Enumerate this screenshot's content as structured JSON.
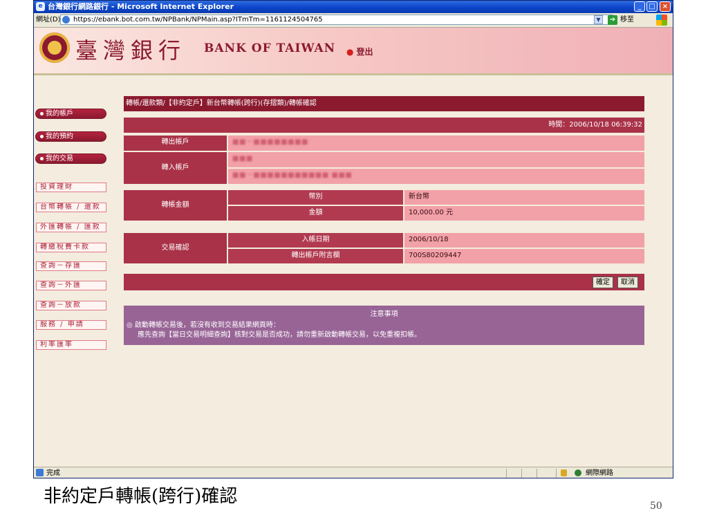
{
  "window": {
    "title": "台灣銀行網路銀行 - Microsoft Internet Explorer"
  },
  "addressbar": {
    "label": "網址(D)",
    "url": "https://ebank.bot.com.tw/NPBank/NPMain.asp?ITmTm=1161124504765",
    "go_label": "移至"
  },
  "banner": {
    "brand_cn": "臺灣銀行",
    "brand_en": "BANK OF TAIWAN",
    "logout": "登出"
  },
  "sidebar": {
    "pills": [
      "我的帳戶",
      "我的預約",
      "我的交易"
    ],
    "items": [
      "投資理財",
      "台幣轉帳 / 還款",
      "外匯轉帳 / 匯款",
      "轉繳稅費卡款",
      "查詢－存匯",
      "查詢－外匯",
      "查詢－放款",
      "服務 / 申請",
      "利率匯率"
    ]
  },
  "main": {
    "breadcrumb": "轉帳/還款類/【非約定戶】新台幣轉帳(跨行)(存摺類)/轉帳確認",
    "time_label": "時間：2006/10/18 06:39:32",
    "rows": {
      "from_account_label": "轉出帳戶",
      "from_account_value": "■■－■■■■■■■■",
      "to_account_label": "轉入帳戶",
      "to_account_value_1": "■■■",
      "to_account_value_2": "■■－■■■■■■■■■■■ ■■■",
      "amount_label": "轉帳金額",
      "currency_label": "幣別",
      "currency_value": "新台幣",
      "amount_sub_label": "金額",
      "amount_value": "10,000.00 元",
      "confirm_label": "交易確認",
      "date_label": "入帳日期",
      "date_value": "2006/10/18",
      "memo_label": "轉出帳戶附言欄",
      "memo_value": "700S80209447"
    },
    "buttons": {
      "confirm": "確定",
      "cancel": "取消"
    },
    "notice": {
      "title": "注意事項",
      "line1": "◎ 啟動轉帳交易後，若沒有收到交易結果網頁時：",
      "line2": "應先查詢【當日交易明細查詢】核對交易是否成功，請勿重新啟動轉帳交易，以免重複扣帳。"
    }
  },
  "statusbar": {
    "status": "完成",
    "zone": "網際網路"
  },
  "slide": {
    "caption": "非約定戶轉帳(跨行)確認",
    "page_number": "50"
  }
}
